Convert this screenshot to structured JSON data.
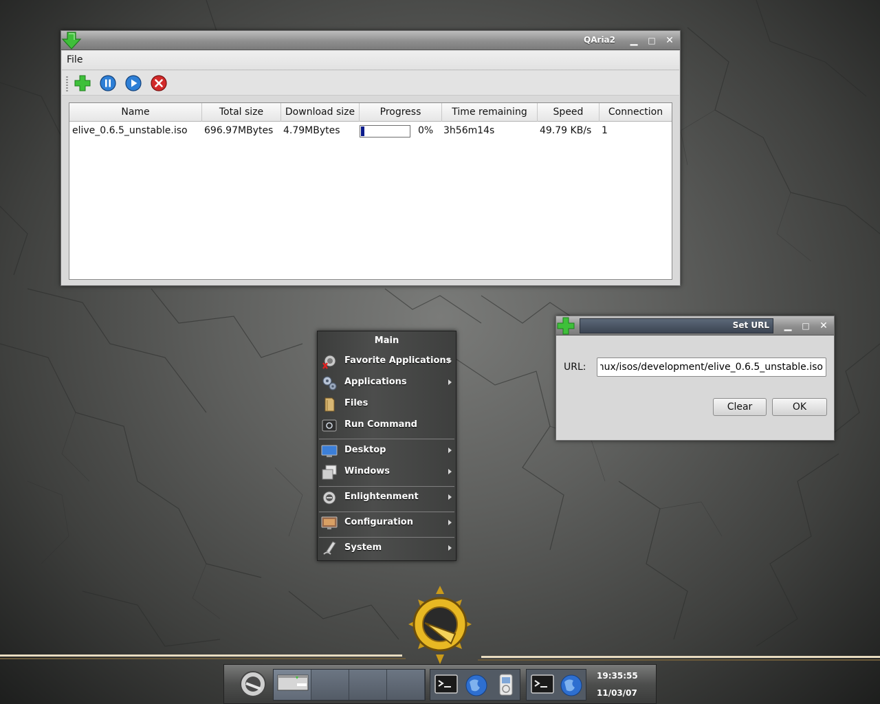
{
  "qaria": {
    "title": "QAria2",
    "menu": {
      "file": "File"
    },
    "toolbar": {
      "add": "add-download",
      "pause": "pause",
      "resume": "resume",
      "remove": "remove"
    },
    "columns": [
      "Name",
      "Total size",
      "Download size",
      "Progress",
      "Time remaining",
      "Speed",
      "Connection"
    ],
    "rows": [
      {
        "name": "elive_0.6.5_unstable.iso",
        "total_size": "696.97MBytes",
        "download_size": "4.79MBytes",
        "progress_percent": 0,
        "progress_label": "0%",
        "time_remaining": "3h56m14s",
        "speed": "49.79 KB/s",
        "connection": "1"
      }
    ]
  },
  "seturl": {
    "title": "Set URL",
    "url_label": "URL:",
    "url_value": "nux/isos/development/elive_0.6.5_unstable.iso",
    "clear_label": "Clear",
    "ok_label": "OK"
  },
  "emenu": {
    "title": "Main",
    "items": [
      {
        "label": "Favorite Applications",
        "submenu": true
      },
      {
        "label": "Applications",
        "submenu": true
      },
      {
        "label": "Files",
        "submenu": false
      },
      {
        "label": "Run Command",
        "submenu": false
      },
      {
        "label": "Desktop",
        "submenu": true
      },
      {
        "label": "Windows",
        "submenu": true
      },
      {
        "label": "Enlightenment",
        "submenu": true
      },
      {
        "label": "Configuration",
        "submenu": true
      },
      {
        "label": "System",
        "submenu": true
      }
    ]
  },
  "shelf": {
    "time": "19:35:55",
    "date": "11/03/07"
  },
  "colors": {
    "progress_fill": "#0b1c8c",
    "menu_bg": "#454645",
    "accent_green": "#2fb52f"
  }
}
